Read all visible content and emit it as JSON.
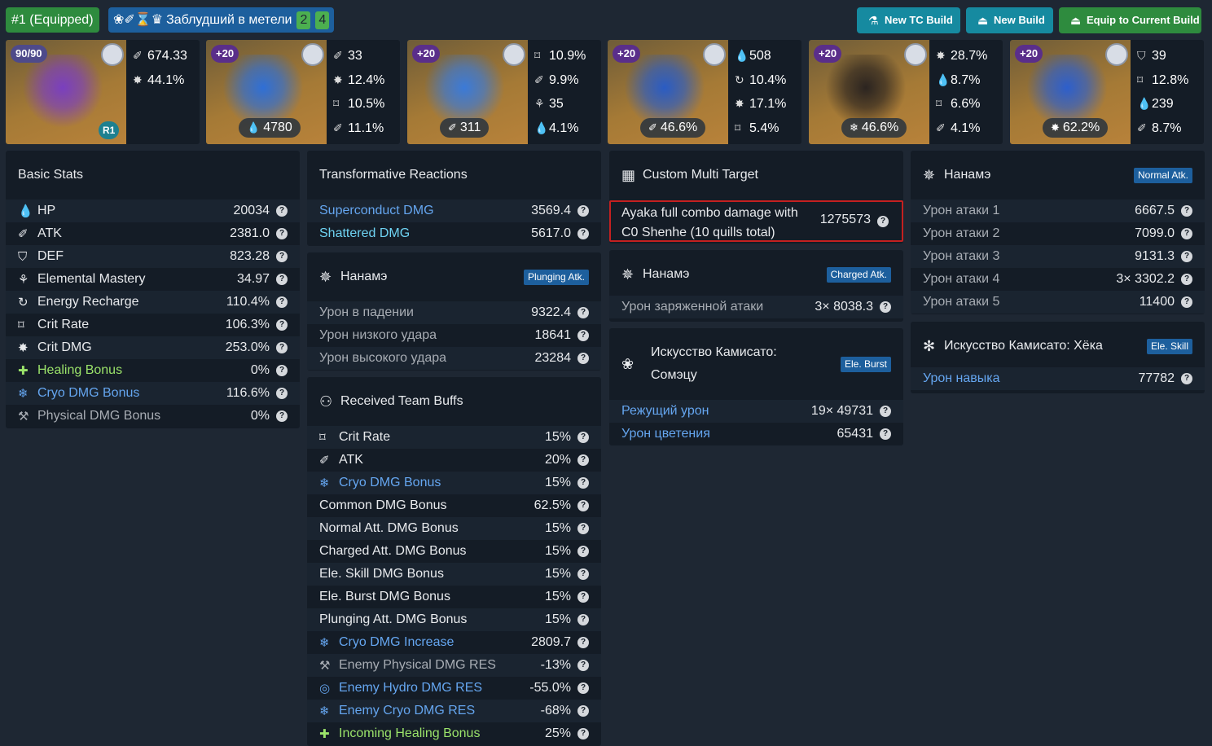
{
  "header": {
    "equipped_label": "#1 (Equipped)",
    "set_icons": "❀✐⌛♛",
    "set_name": "Заблудший в метели",
    "set_count_a": "2",
    "set_count_b": "4",
    "buttons": {
      "new_tc": "New TC Build",
      "new_build": "New Build",
      "equip": "Equip to Current Build"
    }
  },
  "artifacts": [
    {
      "level": "90/90",
      "refine": "R1",
      "main": "",
      "subs": [
        {
          "icon": "✐",
          "value": "674.33"
        },
        {
          "icon": "✸",
          "value": "44.1%"
        }
      ]
    },
    {
      "level": "+20",
      "main": "4780",
      "main_icon": "💧",
      "subs": [
        {
          "icon": "✐",
          "value": "33"
        },
        {
          "icon": "✸",
          "value": "12.4%"
        },
        {
          "icon": "⌑",
          "value": "10.5%"
        },
        {
          "icon": "✐",
          "value": "11.1%"
        }
      ]
    },
    {
      "level": "+20",
      "main": "311",
      "main_icon": "✐",
      "subs": [
        {
          "icon": "⌑",
          "value": "10.9%"
        },
        {
          "icon": "✐",
          "value": "9.9%"
        },
        {
          "icon": "⚘",
          "value": "35"
        },
        {
          "icon": "💧",
          "value": "4.1%"
        }
      ]
    },
    {
      "level": "+20",
      "main": "46.6%",
      "main_icon": "✐",
      "subs": [
        {
          "icon": "💧",
          "value": "508"
        },
        {
          "icon": "↻",
          "value": "10.4%"
        },
        {
          "icon": "✸",
          "value": "17.1%"
        },
        {
          "icon": "⌑",
          "value": "5.4%"
        }
      ]
    },
    {
      "level": "+20",
      "main": "46.6%",
      "main_icon": "❄",
      "subs": [
        {
          "icon": "✸",
          "value": "28.7%"
        },
        {
          "icon": "💧",
          "value": "8.7%"
        },
        {
          "icon": "⌑",
          "value": "6.6%"
        },
        {
          "icon": "✐",
          "value": "4.1%"
        }
      ]
    },
    {
      "level": "+20",
      "main": "62.2%",
      "main_icon": "✸",
      "subs": [
        {
          "icon": "⛉",
          "value": "39"
        },
        {
          "icon": "⌑",
          "value": "12.8%"
        },
        {
          "icon": "💧",
          "value": "239"
        },
        {
          "icon": "✐",
          "value": "8.7%"
        }
      ]
    }
  ],
  "basic_stats": {
    "title": "Basic Stats",
    "rows": [
      {
        "icon": "💧",
        "label": "HP",
        "value": "20034",
        "cls": ""
      },
      {
        "icon": "✐",
        "label": "ATK",
        "value": "2381.0",
        "cls": ""
      },
      {
        "icon": "⛉",
        "label": "DEF",
        "value": "823.28",
        "cls": ""
      },
      {
        "icon": "⚘",
        "label": "Elemental Mastery",
        "value": "34.97",
        "cls": ""
      },
      {
        "icon": "↻",
        "label": "Energy Recharge",
        "value": "110.4%",
        "cls": ""
      },
      {
        "icon": "⌑",
        "label": "Crit Rate",
        "value": "106.3%",
        "cls": ""
      },
      {
        "icon": "✸",
        "label": "Crit DMG",
        "value": "253.0%",
        "cls": ""
      },
      {
        "icon": "✚",
        "label": "Healing Bonus",
        "value": "0%",
        "cls": "green"
      },
      {
        "icon": "❄",
        "label": "Cryo DMG Bonus",
        "value": "116.6%",
        "cls": "blue"
      },
      {
        "icon": "⚒",
        "label": "Physical DMG Bonus",
        "value": "0%",
        "cls": "gray"
      }
    ]
  },
  "transformative": {
    "title": "Transformative Reactions",
    "rows": [
      {
        "label": "Superconduct DMG",
        "value": "3569.4",
        "cls": "blue"
      },
      {
        "label": "Shattered DMG",
        "value": "5617.0",
        "cls": "cyan"
      }
    ]
  },
  "plunge": {
    "title": "Нанамэ",
    "tag": "Plunging Atk.",
    "rows": [
      {
        "label": "Урон в падении",
        "value": "9322.4"
      },
      {
        "label": "Урон низкого удара",
        "value": "18641"
      },
      {
        "label": "Урон высокого удара",
        "value": "23284"
      }
    ]
  },
  "team_buffs": {
    "title": "Received Team Buffs",
    "rows": [
      {
        "icon": "⌑",
        "label": "Crit Rate",
        "value": "15%",
        "cls": ""
      },
      {
        "icon": "✐",
        "label": "ATK",
        "value": "20%",
        "cls": ""
      },
      {
        "icon": "❄",
        "label": "Cryo DMG Bonus",
        "value": "15%",
        "cls": "blue"
      },
      {
        "icon": "",
        "label": "Common DMG Bonus",
        "value": "62.5%",
        "cls": ""
      },
      {
        "icon": "",
        "label": "Normal Att. DMG Bonus",
        "value": "15%",
        "cls": ""
      },
      {
        "icon": "",
        "label": "Charged Att. DMG Bonus",
        "value": "15%",
        "cls": ""
      },
      {
        "icon": "",
        "label": "Ele. Skill DMG Bonus",
        "value": "15%",
        "cls": ""
      },
      {
        "icon": "",
        "label": "Ele. Burst DMG Bonus",
        "value": "15%",
        "cls": ""
      },
      {
        "icon": "",
        "label": "Plunging Att. DMG Bonus",
        "value": "15%",
        "cls": ""
      },
      {
        "icon": "❄",
        "label": "Cryo DMG Increase",
        "value": "2809.7",
        "cls": "blue"
      },
      {
        "icon": "⚒",
        "label": "Enemy Physical DMG RES",
        "value": "-13%",
        "cls": "gray"
      },
      {
        "icon": "◎",
        "label": "Enemy Hydro DMG RES",
        "value": "-55.0%",
        "cls": "blue"
      },
      {
        "icon": "❄",
        "label": "Enemy Cryo DMG RES",
        "value": "-68%",
        "cls": "blue"
      },
      {
        "icon": "✚",
        "label": "Incoming Healing Bonus",
        "value": "25%",
        "cls": "green"
      }
    ]
  },
  "custom_target": {
    "title": "Custom Multi Target",
    "text": "Ayaka full combo damage with C0 Shenhe (10 quills total)",
    "value": "1275573"
  },
  "charged": {
    "title": "Нанамэ",
    "tag": "Charged Atk.",
    "rows": [
      {
        "label": "Урон заряженной атаки",
        "value": "3× 8038.3"
      }
    ]
  },
  "burst": {
    "title": "Искусство Камисато: Сомэцу",
    "tag": "Ele. Burst",
    "rows": [
      {
        "label": "Режущий урон",
        "value": "19× 49731",
        "cls": "blue"
      },
      {
        "label": "Урон цветения",
        "value": "65431",
        "cls": "blue"
      }
    ]
  },
  "normal": {
    "title": "Нанамэ",
    "tag": "Normal Atk.",
    "rows": [
      {
        "label": "Урон атаки 1",
        "value": "6667.5"
      },
      {
        "label": "Урон атаки 2",
        "value": "7099.0"
      },
      {
        "label": "Урон атаки 3",
        "value": "9131.3"
      },
      {
        "label": "Урон атаки 4",
        "value": "3× 3302.2"
      },
      {
        "label": "Урон атаки 5",
        "value": "11400"
      }
    ]
  },
  "skill": {
    "title": "Искусство Камисато: Хёка",
    "tag": "Ele. Skill",
    "rows": [
      {
        "label": "Урон навыка",
        "value": "77782",
        "cls": "blue"
      }
    ]
  }
}
